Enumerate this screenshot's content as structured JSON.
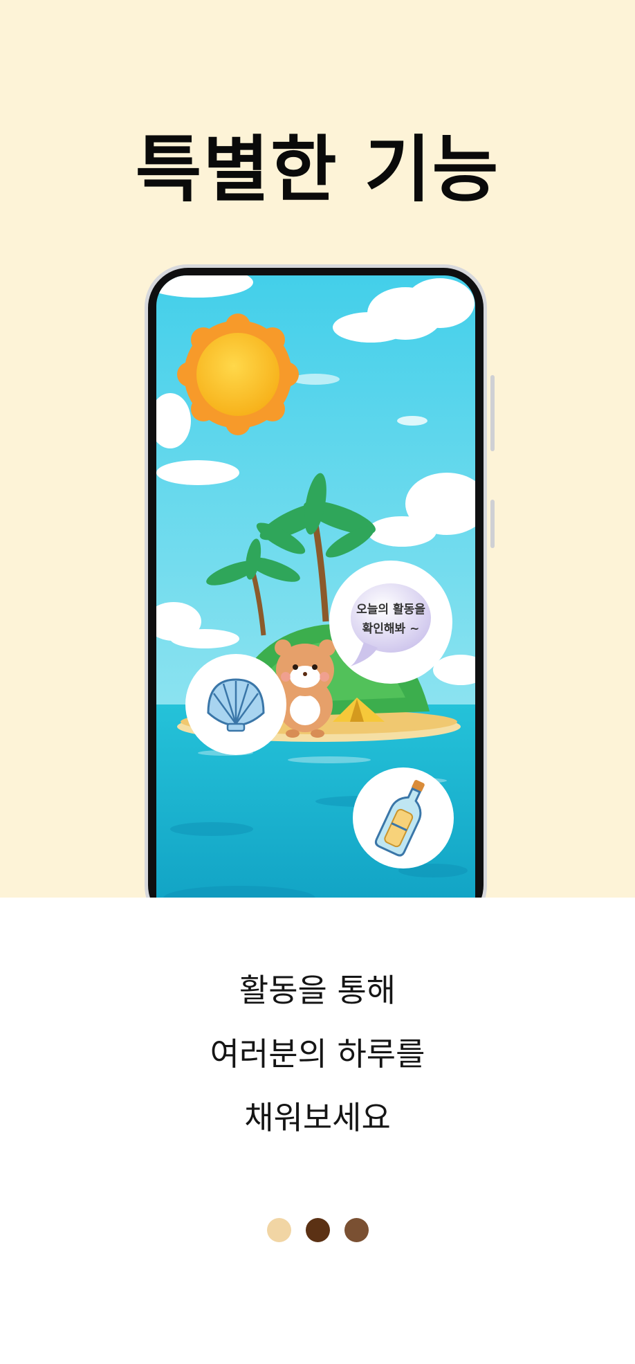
{
  "title": "특별한 기능",
  "speech_bubble": {
    "line1": "오늘의 활동을",
    "line2": "확인해봐 ~"
  },
  "icons": {
    "sun": "sun-icon",
    "shell": "shell-icon",
    "bottle": "message-bottle-icon",
    "character": "hamster-character",
    "island": "island-illustration"
  },
  "caption": {
    "line1": "활동을 통해",
    "line2": "여러분의 하루를",
    "line3": "채워보세요"
  },
  "pagination": {
    "dots": [
      {
        "color": "#f1d5a4"
      },
      {
        "color": "#5b3114"
      },
      {
        "color": "#7a5032"
      }
    ]
  },
  "colors": {
    "background_top": "#fdf3d7",
    "background_bottom": "#ffffff",
    "sky": "#4fd2ea",
    "sea": "#19b2cc"
  }
}
